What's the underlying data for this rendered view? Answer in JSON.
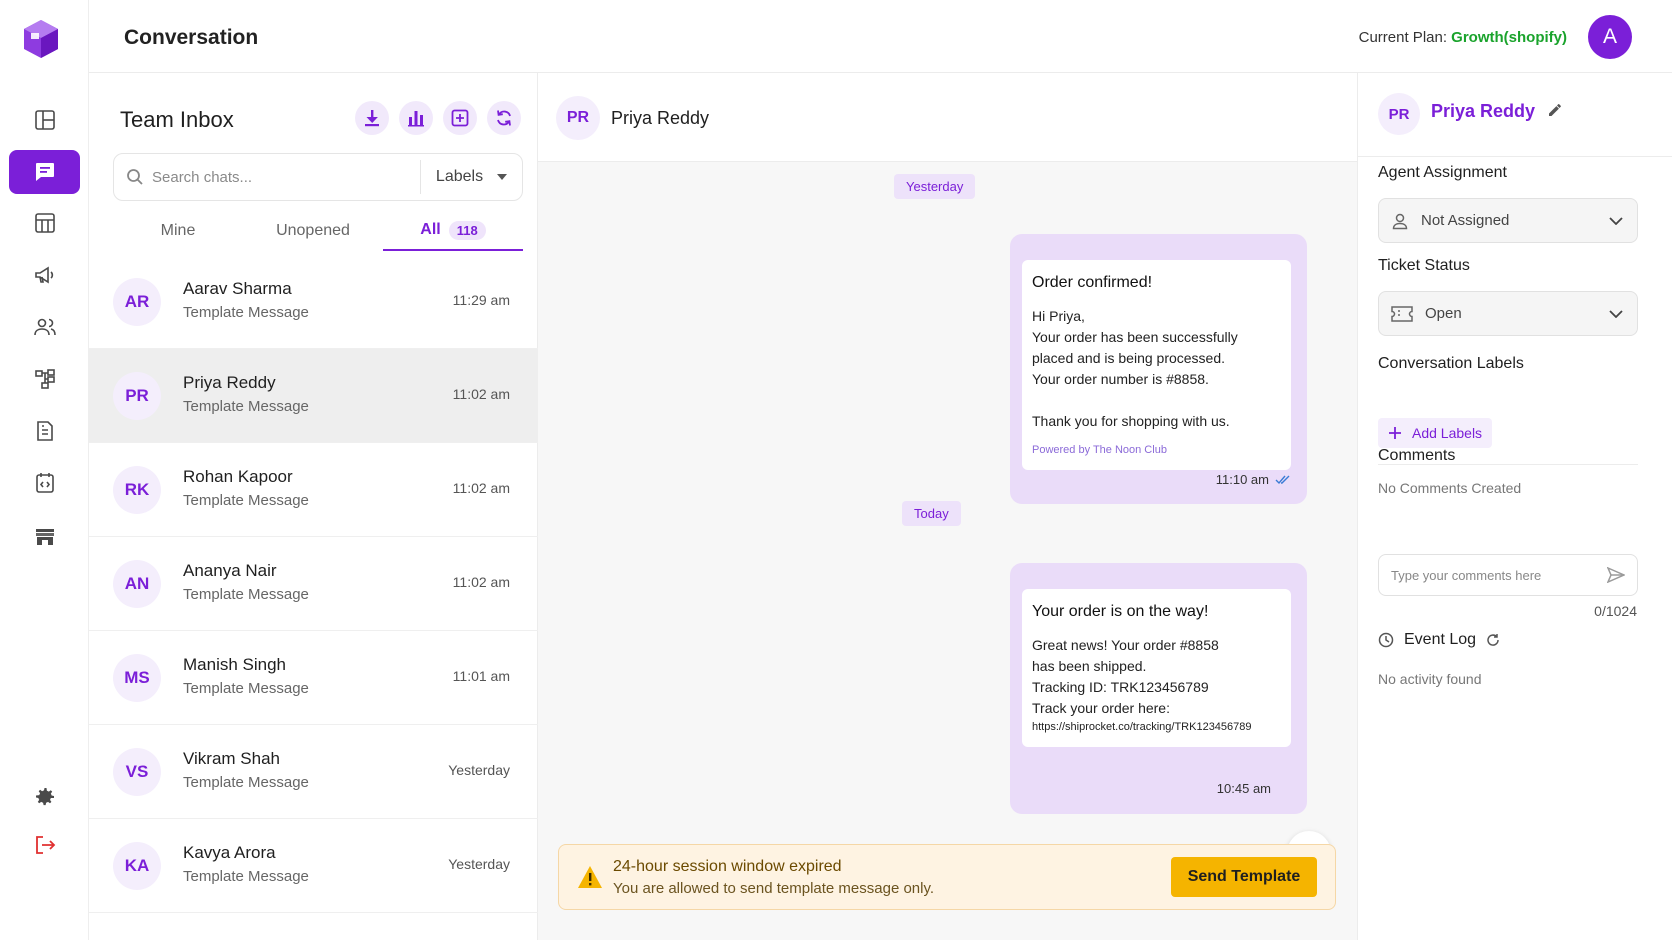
{
  "header": {
    "title": "Conversation",
    "plan_label": "Current Plan:",
    "plan_value": "Growth(shopify)",
    "avatar_letter": "A"
  },
  "sidebar": {
    "items": [
      {
        "icon": "dashboard-icon"
      },
      {
        "icon": "chat-icon",
        "active": true
      },
      {
        "icon": "table-icon"
      },
      {
        "icon": "megaphone-icon"
      },
      {
        "icon": "contacts-icon"
      },
      {
        "icon": "flow-icon"
      },
      {
        "icon": "document-icon"
      },
      {
        "icon": "code-icon"
      },
      {
        "icon": "store-icon"
      }
    ],
    "bottom": [
      {
        "icon": "settings-icon"
      },
      {
        "icon": "logout-icon"
      }
    ]
  },
  "inbox": {
    "title": "Team Inbox",
    "search_placeholder": "Search chats...",
    "labels_dropdown": "Labels",
    "tabs": [
      {
        "label": "Mine"
      },
      {
        "label": "Unopened"
      },
      {
        "label": "All",
        "count": "118",
        "active": true
      }
    ],
    "chats": [
      {
        "initials": "AR",
        "name": "Aarav Sharma",
        "subtitle": "Template Message",
        "time": "11:29 am"
      },
      {
        "initials": "PR",
        "name": "Priya Reddy",
        "subtitle": "Template Message",
        "time": "11:02 am",
        "selected": true
      },
      {
        "initials": "RK",
        "name": "Rohan Kapoor",
        "subtitle": "Template Message",
        "time": "11:02 am"
      },
      {
        "initials": "AN",
        "name": "Ananya Nair",
        "subtitle": "Template Message",
        "time": "11:02 am"
      },
      {
        "initials": "MS",
        "name": "Manish Singh",
        "subtitle": "Template Message",
        "time": "11:01 am"
      },
      {
        "initials": "VS",
        "name": "Vikram Shah",
        "subtitle": "Template Message",
        "time": "Yesterday"
      },
      {
        "initials": "KA",
        "name": "Kavya Arora",
        "subtitle": "Template Message",
        "time": "Yesterday"
      }
    ]
  },
  "chat": {
    "contact_initials": "PR",
    "contact_name": "Priya Reddy",
    "day1": "Yesterday",
    "day2": "Today",
    "msg1": {
      "title": "Order confirmed!",
      "body": "Hi Priya,\nYour order has been successfully\nplaced and is being processed.\nYour order number is #8858.\n\nThank you for shopping with us.",
      "powered": "Powered by The Noon Club",
      "time": "11:10 am"
    },
    "msg2": {
      "title": "Your order is on the way!",
      "body": "Great news! Your order #8858\nhas been shipped.\nTracking ID: TRK123456789\nTrack your order here:",
      "link": "https://shiprocket.co/tracking/TRK123456789",
      "time": "10:45 am"
    },
    "banner": {
      "title": "24-hour session window expired",
      "subtitle": "You are allowed to send template message only.",
      "button": "Send Template"
    }
  },
  "panel": {
    "initials": "PR",
    "name": "Priya Reddy",
    "agent_label": "Agent Assignment",
    "agent_value": "Not Assigned",
    "status_label": "Ticket Status",
    "status_value": "Open",
    "labels_label": "Conversation Labels",
    "add_labels": "Add Labels",
    "comments_label": "Comments",
    "no_comments": "No Comments Created",
    "comment_placeholder": "Type your comments here",
    "char_count": "0/1024",
    "event_log": "Event Log",
    "no_activity": "No activity found"
  },
  "colors": {
    "accent": "#7b1fd8",
    "plan_green": "#1aa32c",
    "warning_bg": "#fef3e2",
    "send_button": "#f5b400"
  }
}
